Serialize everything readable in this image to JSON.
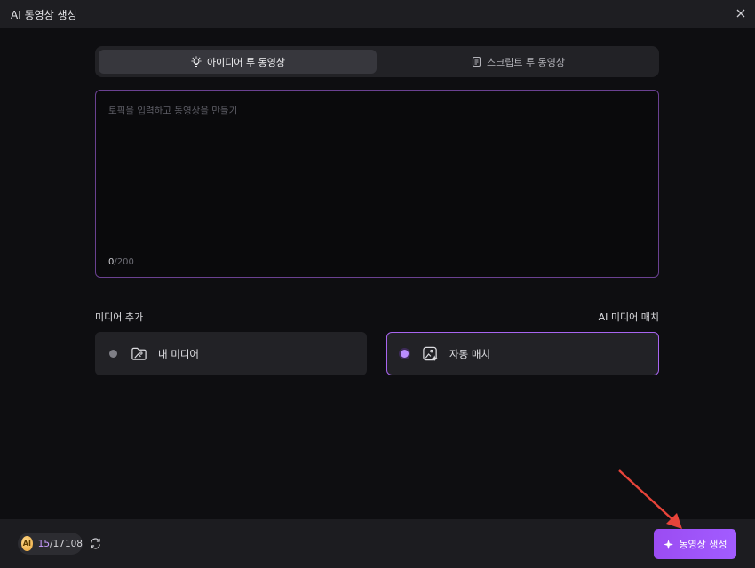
{
  "window": {
    "title": "AI 동영상 생성"
  },
  "tabs": [
    {
      "label": "아이디어 투 동영상",
      "icon": "lightbulb-icon",
      "active": true
    },
    {
      "label": "스크립트 투 동영상",
      "icon": "script-document-icon",
      "active": false
    }
  ],
  "prompt": {
    "placeholder": "토픽을 입력하고 동영상을 만들기",
    "count": "0",
    "max": "/200"
  },
  "media": {
    "add_label": "미디어 추가",
    "match_label": "AI 미디어 매치",
    "options": [
      {
        "label": "내 미디어",
        "icon": "folder-image-icon",
        "selected": false
      },
      {
        "label": "자동 매치",
        "icon": "image-sparkle-icon",
        "selected": true
      }
    ]
  },
  "footer": {
    "ai_badge": "AI",
    "credits_used": "15",
    "credits_total": "/17108",
    "generate_label": "동영상 생성"
  },
  "colors": {
    "accent": "#a25cff",
    "border_active": "#a865f0",
    "annotation_arrow": "#e8443a"
  }
}
